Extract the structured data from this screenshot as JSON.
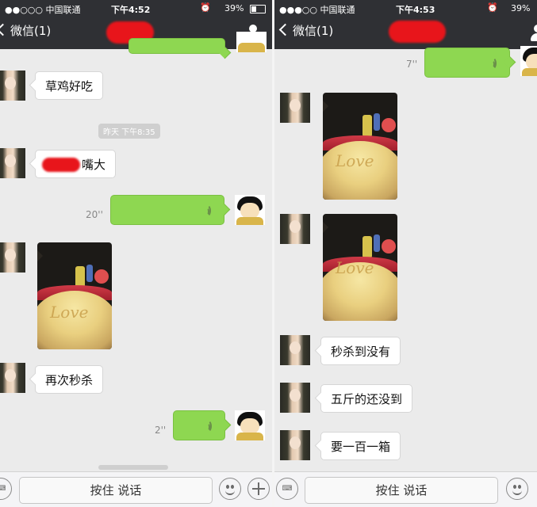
{
  "left": {
    "status": {
      "carrier": "●●○○○ 中国联通",
      "time": "下午4:52",
      "battery": "39%"
    },
    "nav": {
      "back_label": "微信(1)"
    },
    "timestamp": "昨天 下午8:35",
    "messages": {
      "m1": "草鸡好吃",
      "m2": "嘴大",
      "voice1_duration": "20''",
      "m3": "再次秒杀",
      "voice2_duration": "2''"
    },
    "photo_text": "Love",
    "input": {
      "talk_label": "按住 说话"
    }
  },
  "right": {
    "status": {
      "carrier": "●●●○○ 中国联通",
      "time": "下午4:53",
      "battery": "39%"
    },
    "nav": {
      "back_label": "微信(1)"
    },
    "messages": {
      "voice1_duration": "7''",
      "m1": "秒杀到没有",
      "m2": "五斤的还没到",
      "m3": "要一百一箱"
    },
    "photo_text": "Love",
    "input": {
      "talk_label": "按住 说话"
    }
  },
  "colors": {
    "navbar": "#2f3034",
    "chat_bg": "#ebebeb",
    "voice_bubble": "#8ed751",
    "redaction": "#e8151b"
  }
}
